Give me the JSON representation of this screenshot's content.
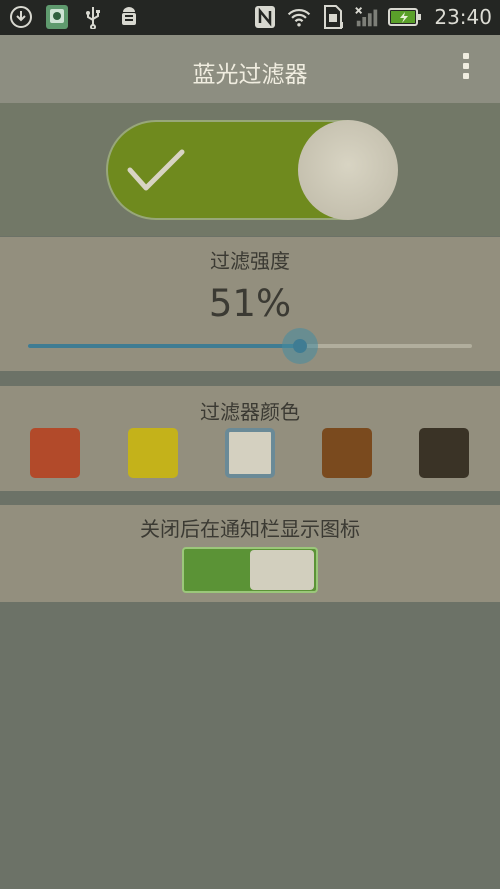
{
  "status_bar": {
    "time": "23:40",
    "icons": [
      "download-icon",
      "app-icon",
      "usb-icon",
      "android-debug-icon",
      "nfc-icon",
      "wifi-icon",
      "sim-icon",
      "signal-icon",
      "battery-icon"
    ]
  },
  "action_bar": {
    "title": "蓝光过滤器",
    "menu_icon": "overflow-menu-icon"
  },
  "master_switch": {
    "on": true,
    "color": "#6f8a1e"
  },
  "intensity": {
    "label": "过滤强度",
    "value_text": "51%",
    "value": 51
  },
  "filter_color": {
    "label": "过滤器颜色",
    "swatches": [
      {
        "color": "#b24a2a",
        "selected": false
      },
      {
        "color": "#c4b21a",
        "selected": false
      },
      {
        "color": "#d4d0c0",
        "selected": true
      },
      {
        "color": "#7a4a1e",
        "selected": false
      },
      {
        "color": "#3a3326",
        "selected": false
      }
    ]
  },
  "notification": {
    "label": "关闭后在通知栏显示图标",
    "on": true
  }
}
